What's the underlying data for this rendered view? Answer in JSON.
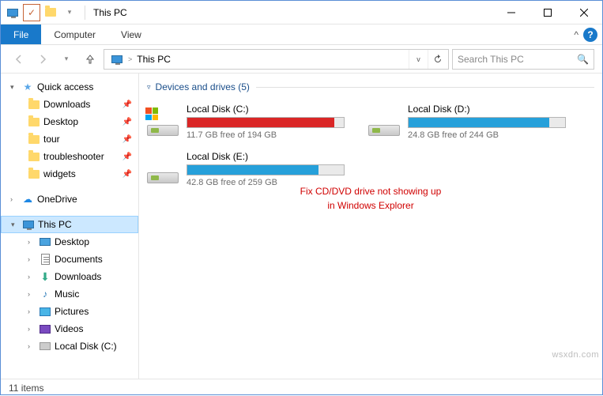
{
  "titlebar": {
    "title": "This PC"
  },
  "ribbon": {
    "tabs": {
      "file": "File",
      "computer": "Computer",
      "view": "View"
    }
  },
  "nav": {
    "breadcrumb_sep": ">",
    "location": "This PC",
    "search_placeholder": "Search This PC"
  },
  "sidebar": {
    "quick_access": "Quick access",
    "qa_items": [
      {
        "label": "Downloads"
      },
      {
        "label": "Desktop"
      },
      {
        "label": "tour"
      },
      {
        "label": "troubleshooter"
      },
      {
        "label": "widgets"
      }
    ],
    "onedrive": "OneDrive",
    "this_pc": "This PC",
    "pc_items": [
      {
        "label": "Desktop"
      },
      {
        "label": "Documents"
      },
      {
        "label": "Downloads"
      },
      {
        "label": "Music"
      },
      {
        "label": "Pictures"
      },
      {
        "label": "Videos"
      },
      {
        "label": "Local Disk (C:)"
      }
    ]
  },
  "content": {
    "group_label": "Devices and drives (5)",
    "drives": [
      {
        "name": "Local Disk (C:)",
        "free_text": "11.7 GB free of 194 GB",
        "fill_pct": 94,
        "color": "red",
        "oslogo": true
      },
      {
        "name": "Local Disk (D:)",
        "free_text": "24.8 GB free of 244 GB",
        "fill_pct": 90,
        "color": "blue",
        "oslogo": false
      },
      {
        "name": "Local Disk (E:)",
        "free_text": "42.8 GB free of 259 GB",
        "fill_pct": 84,
        "color": "blue",
        "oslogo": false
      }
    ],
    "overlay_line1": "Fix CD/DVD drive not showing up",
    "overlay_line2": "in Windows Explorer"
  },
  "statusbar": {
    "items": "11 items"
  },
  "watermark": "wsxdn.com",
  "chart_data": {
    "type": "bar",
    "title": "Drive usage",
    "series": [
      {
        "name": "Local Disk (C:)",
        "free_gb": 11.7,
        "total_gb": 194
      },
      {
        "name": "Local Disk (D:)",
        "free_gb": 24.8,
        "total_gb": 244
      },
      {
        "name": "Local Disk (E:)",
        "free_gb": 42.8,
        "total_gb": 259
      }
    ]
  }
}
